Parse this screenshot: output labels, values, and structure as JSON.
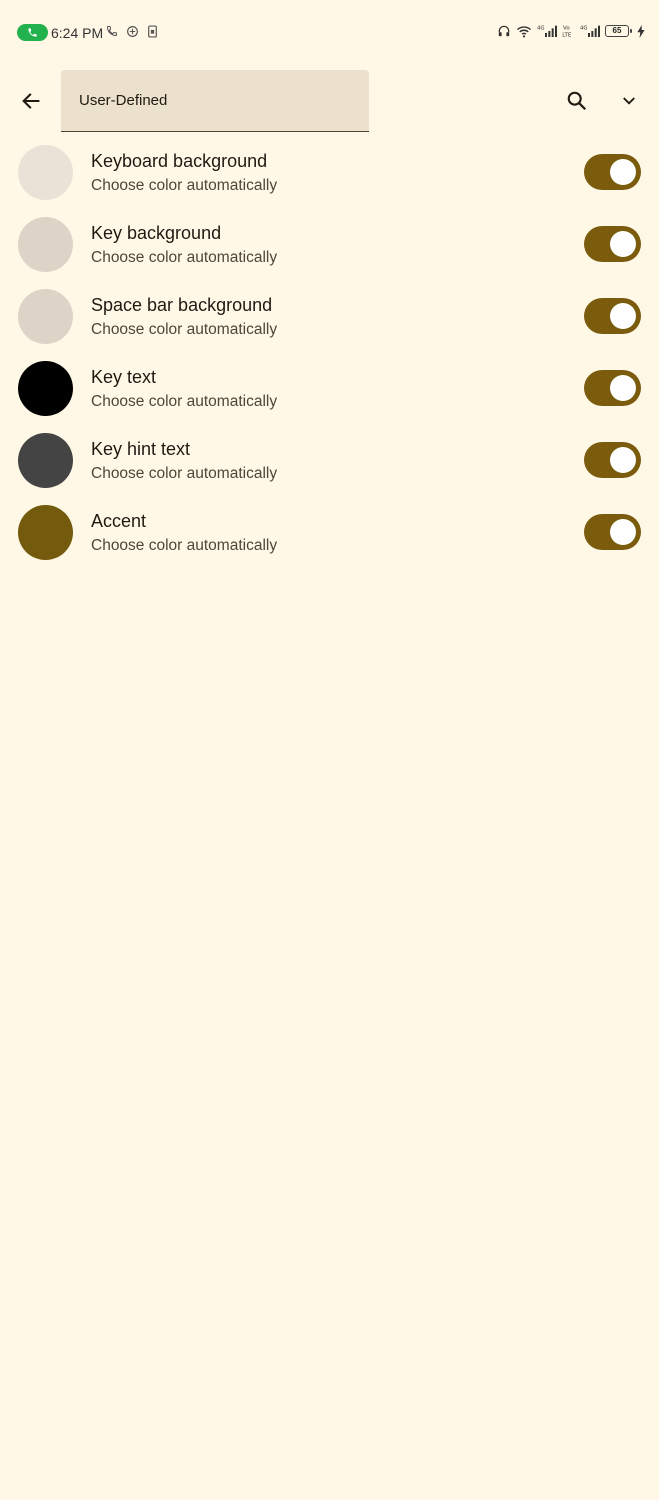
{
  "status_bar": {
    "time": "6:24 PM",
    "battery": "65",
    "call_color": "#22b14c",
    "icons_left": [
      "phone-icon",
      "vpn-icon",
      "sim-icon"
    ],
    "icons_right": [
      "headphones-icon",
      "wifi-icon",
      "signal-icon",
      "volte-icon",
      "signal-icon",
      "battery-icon",
      "charging-icon"
    ]
  },
  "toolbar": {
    "dropdown_value": "User-Defined",
    "back_icon": "arrow-back-icon",
    "search_icon": "search-icon",
    "more_icon": "chevron-down-icon"
  },
  "theme": {
    "accent": "#7a5c0c",
    "background": "#fff8e6"
  },
  "items": [
    {
      "title": "Keyboard background",
      "subtitle": "Choose color automatically",
      "swatch": "#e9e2d6",
      "enabled": true
    },
    {
      "title": "Key background",
      "subtitle": "Choose color automatically",
      "swatch": "#ddd3c6",
      "enabled": true
    },
    {
      "title": "Space bar background",
      "subtitle": "Choose color automatically",
      "swatch": "#ddd3c6",
      "enabled": true
    },
    {
      "title": "Key text",
      "subtitle": "Choose color automatically",
      "swatch": "#000000",
      "enabled": true
    },
    {
      "title": "Key hint text",
      "subtitle": "Choose color automatically",
      "swatch": "#444444",
      "enabled": true
    },
    {
      "title": "Accent",
      "subtitle": "Choose color automatically",
      "swatch": "#745a0c",
      "enabled": true
    }
  ]
}
